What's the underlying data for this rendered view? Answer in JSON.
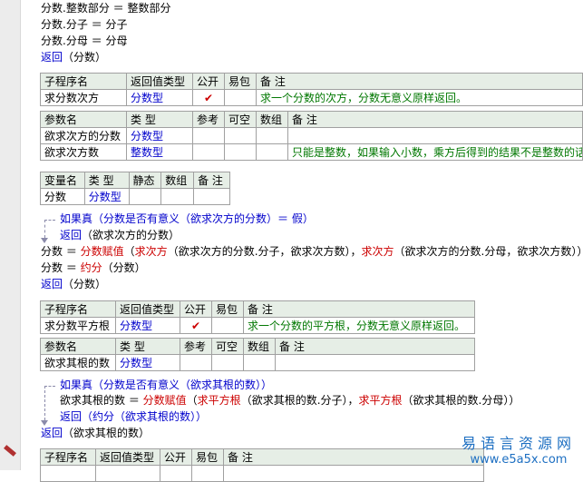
{
  "code": {
    "l1": "分数.整数部分 ＝ 整数部分",
    "l2": "分数.分子 ＝ 分子",
    "l3": "分数.分母 ＝ 分母",
    "l4_kw": "返回",
    "l4_arg": "（分数）"
  },
  "table1": {
    "header": [
      "子程序名",
      "返回值类型",
      "公开",
      "易包",
      "备 注"
    ],
    "row": {
      "name": "求分数次方",
      "type": "分数型",
      "public": "✔",
      "pack": "",
      "note": "求一个分数的次方，分数无意义原样返回。"
    },
    "param_header": [
      "参数名",
      "类 型",
      "参考",
      "可空",
      "数组",
      "备 注"
    ],
    "params": [
      {
        "name": "欲求次方的分数",
        "type": "分数型",
        "ref": "",
        "nullable": "",
        "array": "",
        "note": ""
      },
      {
        "name": "欲求次方数",
        "type": "整数型",
        "ref": "",
        "nullable": "",
        "array": "",
        "note": "只能是整数，如果输入小数，乘方后得到的结果不是整数的话"
      }
    ]
  },
  "vartable": {
    "header": [
      "变量名",
      "类 型",
      "静态",
      "数组",
      "备 注"
    ],
    "row": {
      "name": "分数",
      "type": "分数型",
      "static": "",
      "array": "",
      "note": ""
    }
  },
  "code2": {
    "if_kw": "如果真",
    "if_cond": "（分数是否有意义（欲求次方的分数）＝ 假）",
    "ret_kw": "返回",
    "ret_arg": "（欲求次方的分数）",
    "assign1_lhs": "分数 ＝ ",
    "assign1_fn": "分数赋值",
    "assign1_p1": "（",
    "assign1_fn2": "求次方",
    "assign1_p2": "（欲求次方的分数.分子，欲求次方数），",
    "assign1_fn3": "求次方",
    "assign1_p3": "（欲求次方的分数.分母，欲求次方数））",
    "assign2_lhs": "分数 ＝ ",
    "assign2_fn": "约分",
    "assign2_arg": "（分数）",
    "ret2_kw": "返回",
    "ret2_arg": "（分数）"
  },
  "table2": {
    "header": [
      "子程序名",
      "返回值类型",
      "公开",
      "易包",
      "备 注"
    ],
    "row": {
      "name": "求分数平方根",
      "type": "分数型",
      "public": "✔",
      "pack": "",
      "note": "求一个分数的平方根，分数无意义原样返回。"
    },
    "param_header": [
      "参数名",
      "类 型",
      "参考",
      "可空",
      "数组",
      "备 注"
    ],
    "params": [
      {
        "name": "欲求其根的数",
        "type": "分数型",
        "ref": "",
        "nullable": "",
        "array": "",
        "note": ""
      }
    ]
  },
  "code3": {
    "if_kw": "如果真",
    "if_cond": "（分数是否有意义（欲求其根的数））",
    "assign_lhs": "欲求其根的数 ＝ ",
    "assign_fn": "分数赋值",
    "assign_p1": "（",
    "assign_fn2": "求平方根",
    "assign_p2": "（欲求其根的数.分子），",
    "assign_fn3": "求平方根",
    "assign_p3": "（欲求其根的数.分母））",
    "ret_kw": "返回",
    "ret_arg": "（约分（欲求其根的数））",
    "ret2_kw": "返回",
    "ret2_arg": "（欲求其根的数）"
  },
  "table3": {
    "header": [
      "子程序名",
      "返回值类型",
      "公开",
      "易包",
      "备 注"
    ]
  },
  "watermark": {
    "line1": "易语言资源网",
    "line2": "www.e5a5x.com"
  }
}
